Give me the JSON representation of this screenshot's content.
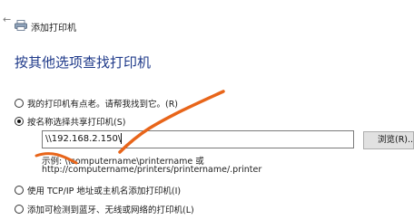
{
  "window": {
    "title": "添加打印机"
  },
  "icons": {
    "back": "back-arrow-icon",
    "printer": "printer-icon"
  },
  "main": {
    "heading": "按其他选项查找打印机",
    "options": [
      {
        "label": "我的打印机有点老。请帮我找到它。(R)",
        "checked": false
      },
      {
        "label": "按名称选择共享打印机(S)",
        "checked": true
      },
      {
        "label": "使用 TCP/IP 地址或主机名添加打印机(I)",
        "checked": false
      },
      {
        "label": "添加可检测到蓝牙、无线或网络的打印机(L)",
        "checked": false
      }
    ],
    "printer_name_input": {
      "value": "\\\\192.168.2.150\\"
    },
    "browse_label": "浏览(R)...",
    "example_line1": "示例: \\\\computername\\printername 或",
    "example_line2": "http://computername/printers/printername/.printer"
  },
  "colors": {
    "heading": "#1f3a8a",
    "annotation": "#e8651a",
    "button_bg": "#e1e1e1"
  }
}
